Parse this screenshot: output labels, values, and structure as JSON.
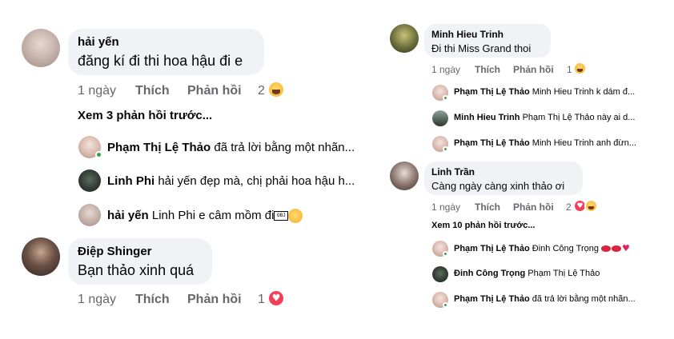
{
  "left": {
    "c1": {
      "name": "hải yến",
      "text": "đăng kí đi thi hoa hậu đi e",
      "time": "1 ngày",
      "like": "Thích",
      "reply": "Phản hồi",
      "count": "2",
      "view_more": "Xem 3 phản hồi trước...",
      "replies": [
        {
          "name": "Phạm Thị Lệ Thảo",
          "text": "đã trả lời bằng một nhãn..."
        },
        {
          "name": "Linh Phi",
          "text": "hải yến đẹp mà, chị  phải hoa hậu h..."
        },
        {
          "name": "hải yến",
          "text": "Linh Phi e câm mồm đi",
          "obj": "OBJ"
        }
      ]
    },
    "c2": {
      "name": "Điệp Shinger",
      "text": "Bạn thảo xinh quá",
      "time": "1 ngày",
      "like": "Thích",
      "reply": "Phản hồi",
      "count": "1"
    }
  },
  "right": {
    "c1": {
      "name": "Minh Hieu Trinh",
      "text": "Đi thi Miss Grand thoi",
      "time": "1 ngày",
      "like": "Thích",
      "reply": "Phản hồi",
      "count": "1",
      "replies": [
        {
          "name": "Phạm Thị Lệ Thảo",
          "text": "Minh Hieu Trinh k dám đ..."
        },
        {
          "name": "Minh Hieu Trinh",
          "text": "Phạm Thị Lệ Thảo này ai d..."
        },
        {
          "name": "Phạm Thị Lệ Thảo",
          "text": "Minh Hieu Trinh anh đừn..."
        }
      ]
    },
    "c2": {
      "name": "Linh Trần",
      "text": "Càng ngày càng xinh thảo ơi",
      "time": "1 ngày",
      "like": "Thích",
      "reply": "Phản hồi",
      "count": "2",
      "view_more": "Xem 10 phản hồi trước...",
      "replies": [
        {
          "name": "Phạm Thị Lệ Thảo",
          "text": "Đinh Công Trọng"
        },
        {
          "name": "Đinh Công Trọng",
          "text": "Phạm Thị Lệ Thảo"
        },
        {
          "name": "Phạm Thị Lệ Thảo",
          "text": "đã trả lời bằng một nhãn..."
        }
      ]
    }
  },
  "icons": [
    "haha-reaction-icon",
    "love-reaction-icon",
    "rolling-laugh-emoji",
    "kiss-lips-emoji",
    "red-heart-emoji"
  ],
  "colors": {
    "bubble": "#f0f2f5",
    "meta": "#65676b",
    "online": "#31a24c",
    "love": "#f33e58",
    "haha": "#f7b125"
  }
}
